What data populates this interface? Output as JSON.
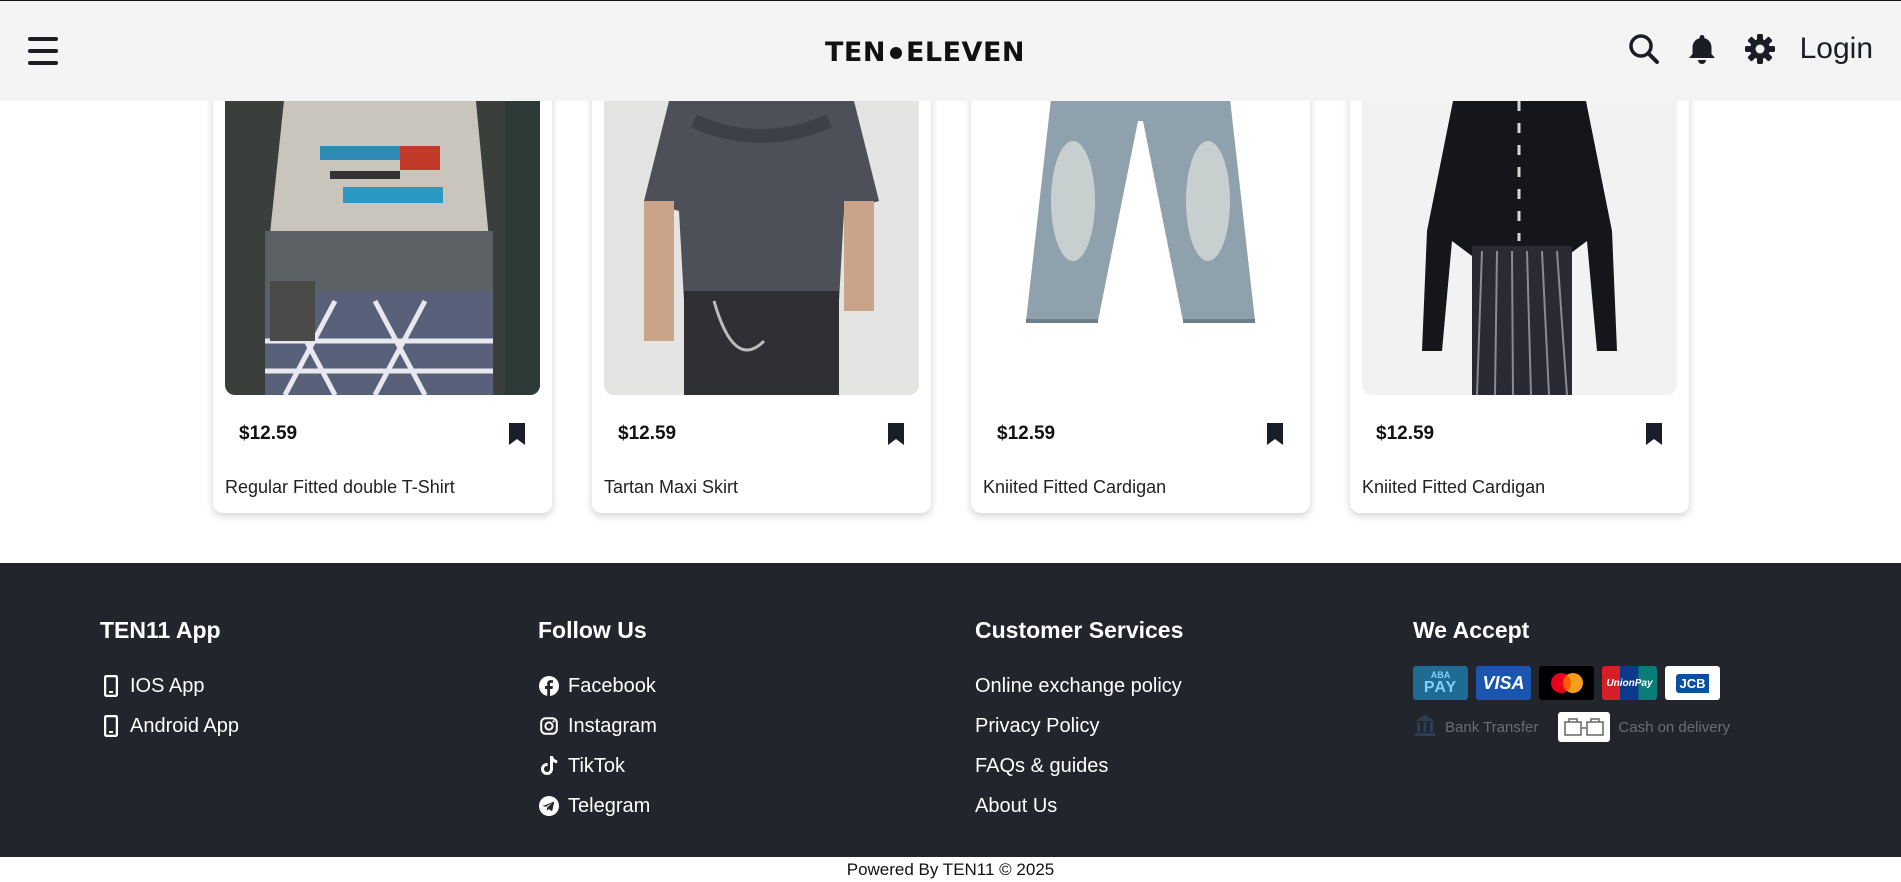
{
  "header": {
    "logo_left": "TEN",
    "logo_right": "ELEVEN",
    "login_label": "Login"
  },
  "products": [
    {
      "price": "$12.59",
      "name": "Regular Fitted double T-Shirt"
    },
    {
      "price": "$12.59",
      "name": "Tartan Maxi Skirt"
    },
    {
      "price": "$12.59",
      "name": "Kniited Fitted Cardigan"
    },
    {
      "price": "$12.59",
      "name": "Kniited Fitted Cardigan"
    }
  ],
  "footer": {
    "app": {
      "title": "TEN11 App",
      "links": [
        "IOS App",
        "Android App"
      ]
    },
    "follow": {
      "title": "Follow Us",
      "links": [
        "Facebook",
        "Instagram",
        "TikTok",
        "Telegram"
      ]
    },
    "services": {
      "title": "Customer Services",
      "links": [
        "Online exchange policy",
        "Privacy Policy",
        "FAQs & guides",
        "About Us"
      ]
    },
    "accept": {
      "title": "We Accept",
      "cards": [
        "ABA PAY",
        "VISA",
        "Mastercard",
        "UnionPay",
        "JCB"
      ],
      "aba_small": "ABA",
      "aba_big": "PAY",
      "visa": "VISA",
      "unionpay": "UnionPay",
      "jcb": "JCB",
      "bank_transfer": "Bank Transfer",
      "cash_on_delivery": "Cash on delivery"
    }
  },
  "copyright": "Powered By TEN11 © 2025",
  "colors": {
    "header_bg": "#f4f4f4",
    "footer_bg": "#22252c",
    "icon_dark": "#1a1d24"
  }
}
